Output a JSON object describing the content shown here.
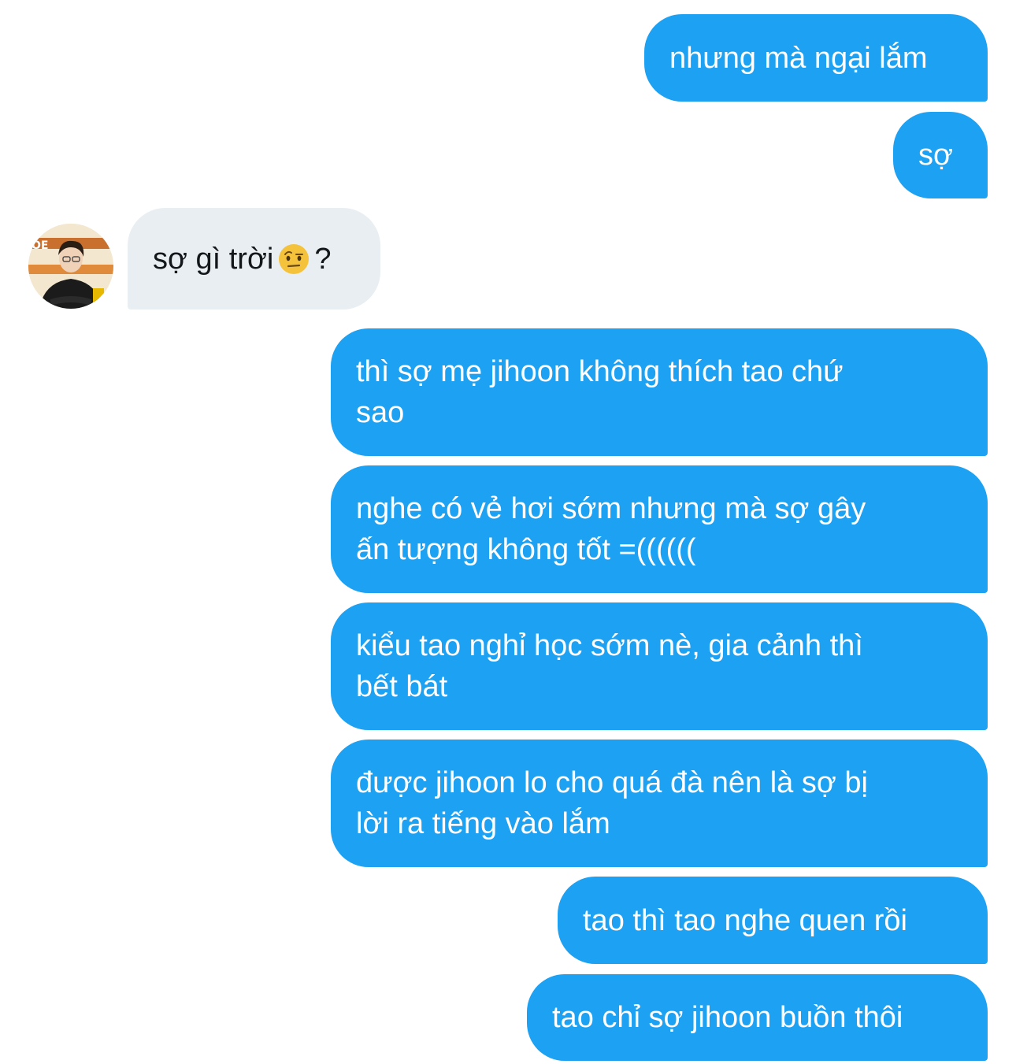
{
  "messages": [
    {
      "text": "nhưng mà ngại lắm"
    },
    {
      "text": "sợ"
    },
    {
      "text_before": "sợ gì trời",
      "emoji": "raised-eyebrow-emoji",
      "text_after": "?"
    },
    {
      "text": "thì sợ mẹ jihoon không thích tao chứ\nsao"
    },
    {
      "text": "nghe có vẻ hơi sớm nhưng mà sợ gây\nấn tượng không tốt =(((((("
    },
    {
      "text": "kiểu tao nghỉ học sớm nè, gia cảnh thì\nbết bát"
    },
    {
      "text": "được jihoon lo cho quá đà nên là sợ bị\nlời ra tiếng vào lắm"
    },
    {
      "text": "tao thì tao nghe quen rồi"
    },
    {
      "text": "tao chỉ sợ jihoon buồn thôi"
    }
  ],
  "colors": {
    "outgoing_bubble": "#1da1f2",
    "incoming_bubble": "#e9eef2",
    "outgoing_text": "#ffffff",
    "incoming_text": "#14171a"
  }
}
